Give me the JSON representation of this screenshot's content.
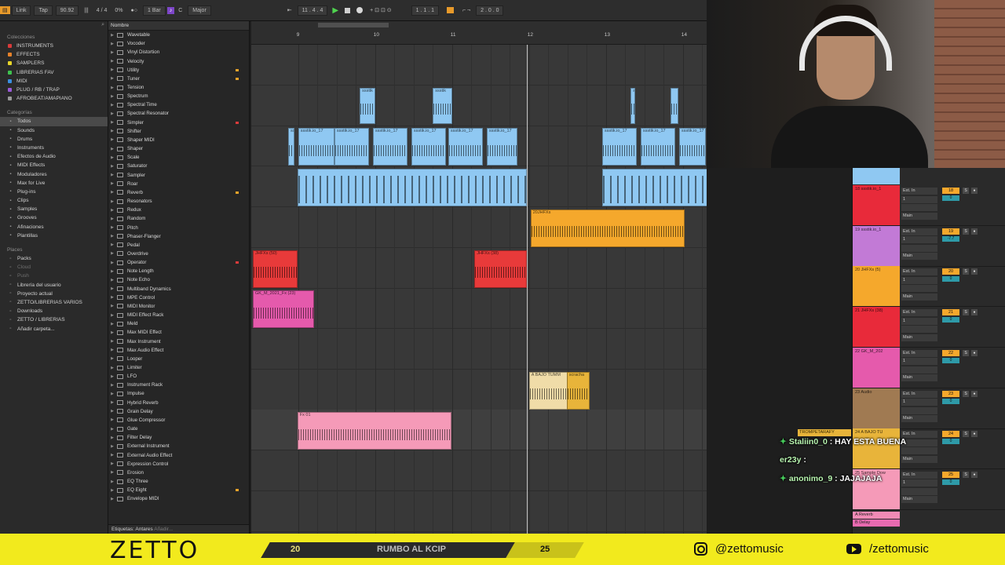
{
  "toolbar": {
    "link": "Link",
    "tap": "Tap",
    "tempo": "90.92",
    "signature": "4 / 4",
    "cpu": "0%",
    "quantize": "1 Bar",
    "key": "C",
    "scale": "Major",
    "position": "11 .   4 .   4",
    "loop_start": "1 .   1 .   1",
    "loop_length": "2 .   0 .   0"
  },
  "browser": {
    "collections_title": "Colecciones",
    "collections": [
      {
        "label": "INSTRUMENTS",
        "color": "#d93b3b"
      },
      {
        "label": "EFFECTS",
        "color": "#e8822a"
      },
      {
        "label": "SAMPLERS",
        "color": "#e8d62a"
      },
      {
        "label": "LIBRERIAS FAV",
        "color": "#3ec24f"
      },
      {
        "label": "MIDI",
        "color": "#3a8fe0"
      },
      {
        "label": "PLUG / RB / TRAP",
        "color": "#9b5ad8"
      },
      {
        "label": "AFROBEAT/AMAPIANO",
        "color": "#9a9a9a"
      }
    ],
    "categories_title": "Categorías",
    "categories": [
      {
        "label": "Todos",
        "icon": "grid-icon"
      },
      {
        "label": "Sounds",
        "icon": "sound-icon"
      },
      {
        "label": "Drums",
        "icon": "drum-icon"
      },
      {
        "label": "Instruments",
        "icon": "instrument-icon"
      },
      {
        "label": "Efectos de Audio",
        "icon": "audio-effect-icon"
      },
      {
        "label": "MIDI Effects",
        "icon": "midi-effect-icon"
      },
      {
        "label": "Moduladores",
        "icon": "modulator-icon"
      },
      {
        "label": "Max for Live",
        "icon": "max-icon"
      },
      {
        "label": "Plug-ins",
        "icon": "plugin-icon"
      },
      {
        "label": "Clips",
        "icon": "clip-icon"
      },
      {
        "label": "Samples",
        "icon": "sample-icon"
      },
      {
        "label": "Grooves",
        "icon": "groove-icon"
      },
      {
        "label": "Afinaciones",
        "icon": "tuning-icon"
      },
      {
        "label": "Plantillas",
        "icon": "template-icon"
      }
    ],
    "places_title": "Places",
    "places": [
      {
        "label": "Packs",
        "icon": "pack-icon",
        "dim": false
      },
      {
        "label": "Cloud",
        "icon": "cloud-icon",
        "dim": true
      },
      {
        "label": "Push",
        "icon": "push-icon",
        "dim": true
      },
      {
        "label": "Librería del usuario",
        "icon": "folder-icon",
        "dim": false
      },
      {
        "label": "Proyecto actual",
        "icon": "folder-icon",
        "dim": false
      },
      {
        "label": "ZETTO/LIBRERIAS VARIOS",
        "icon": "folder-icon",
        "dim": false
      },
      {
        "label": "Downloads",
        "icon": "folder-icon",
        "dim": false
      },
      {
        "label": "ZETTO / LIBRERIAS",
        "icon": "folder-icon",
        "dim": false
      },
      {
        "label": "Añadir carpeta...",
        "icon": "add-icon",
        "dim": false
      }
    ]
  },
  "filelist": {
    "header": "Nombre",
    "items": [
      {
        "label": "Wavetable",
        "mark": ""
      },
      {
        "label": "Vocoder",
        "mark": ""
      },
      {
        "label": "Vinyl Distortion",
        "mark": ""
      },
      {
        "label": "Velocity",
        "mark": ""
      },
      {
        "label": "Utility",
        "mark": "#e8a32a"
      },
      {
        "label": "Tuner",
        "mark": "#e8a32a"
      },
      {
        "label": "Tension",
        "mark": ""
      },
      {
        "label": "Spectrum",
        "mark": ""
      },
      {
        "label": "Spectral Time",
        "mark": ""
      },
      {
        "label": "Spectral Resonator",
        "mark": ""
      },
      {
        "label": "Simpler",
        "mark": "#d93b3b"
      },
      {
        "label": "Shifter",
        "mark": ""
      },
      {
        "label": "Shaper MIDI",
        "mark": ""
      },
      {
        "label": "Shaper",
        "mark": ""
      },
      {
        "label": "Scale",
        "mark": ""
      },
      {
        "label": "Saturator",
        "mark": ""
      },
      {
        "label": "Sampler",
        "mark": ""
      },
      {
        "label": "Roar",
        "mark": ""
      },
      {
        "label": "Reverb",
        "mark": "#e8a32a"
      },
      {
        "label": "Resonators",
        "mark": ""
      },
      {
        "label": "Redux",
        "mark": ""
      },
      {
        "label": "Random",
        "mark": ""
      },
      {
        "label": "Pitch",
        "mark": ""
      },
      {
        "label": "Phaser-Flanger",
        "mark": ""
      },
      {
        "label": "Pedal",
        "mark": ""
      },
      {
        "label": "Overdrive",
        "mark": ""
      },
      {
        "label": "Operator",
        "mark": "#d93b3b"
      },
      {
        "label": "Note Length",
        "mark": ""
      },
      {
        "label": "Note Echo",
        "mark": ""
      },
      {
        "label": "Multiband Dynamics",
        "mark": ""
      },
      {
        "label": "MPE Control",
        "mark": ""
      },
      {
        "label": "MIDI Monitor",
        "mark": ""
      },
      {
        "label": "MIDI Effect Rack",
        "mark": ""
      },
      {
        "label": "Meld",
        "mark": ""
      },
      {
        "label": "Max MIDI Effect",
        "mark": ""
      },
      {
        "label": "Max Instrument",
        "mark": ""
      },
      {
        "label": "Max Audio Effect",
        "mark": ""
      },
      {
        "label": "Looper",
        "mark": ""
      },
      {
        "label": "Limiter",
        "mark": ""
      },
      {
        "label": "LFO",
        "mark": ""
      },
      {
        "label": "Instrument Rack",
        "mark": ""
      },
      {
        "label": "Impulse",
        "mark": ""
      },
      {
        "label": "Hybrid Reverb",
        "mark": ""
      },
      {
        "label": "Grain Delay",
        "mark": ""
      },
      {
        "label": "Glue Compressor",
        "mark": ""
      },
      {
        "label": "Gate",
        "mark": ""
      },
      {
        "label": "Filter Delay",
        "mark": ""
      },
      {
        "label": "External Instrument",
        "mark": ""
      },
      {
        "label": "External Audio Effect",
        "mark": ""
      },
      {
        "label": "Expression Control",
        "mark": ""
      },
      {
        "label": "Erosion",
        "mark": ""
      },
      {
        "label": "EQ Three",
        "mark": ""
      },
      {
        "label": "EQ Eight",
        "mark": "#e8a32a"
      },
      {
        "label": "Envelope MIDI",
        "mark": ""
      }
    ],
    "footer_label": "Etiquetas:",
    "footer_tag": "Antares",
    "footer_add": "Añadir..."
  },
  "ruler": {
    "bars": [
      "9",
      "10",
      "11",
      "12",
      "13",
      "14"
    ]
  },
  "clips": [
    {
      "name": "ssstik",
      "lane": 2,
      "bar": 9.8,
      "len": 0.2,
      "color": "#8fc8f2",
      "style": "wave"
    },
    {
      "name": "ssstik",
      "lane": 2,
      "bar": 10.75,
      "len": 0.25,
      "color": "#8fc8f2",
      "style": "wave"
    },
    {
      "name": "s",
      "lane": 2,
      "bar": 13.32,
      "len": 0.06,
      "color": "#8fc8f2",
      "style": "wave"
    },
    {
      "name": "",
      "lane": 2,
      "bar": 13.84,
      "len": 0.1,
      "color": "#8fc8f2",
      "style": "wave"
    },
    {
      "name": "ssstik.io_17",
      "lane": 3,
      "bar": 8.87,
      "len": 0.08,
      "color": "#8fc8f2",
      "style": "wave"
    },
    {
      "name": "ssstik.io_17",
      "lane": 3,
      "bar": 9.0,
      "len": 0.47,
      "color": "#8fc8f2",
      "style": "wave"
    },
    {
      "name": "ssstik.io_17",
      "lane": 3,
      "bar": 9.47,
      "len": 0.45,
      "color": "#8fc8f2",
      "style": "wave"
    },
    {
      "name": "ssstik.io_17",
      "lane": 3,
      "bar": 9.97,
      "len": 0.45,
      "color": "#8fc8f2",
      "style": "wave"
    },
    {
      "name": "ssstik.io_17",
      "lane": 3,
      "bar": 10.47,
      "len": 0.45,
      "color": "#8fc8f2",
      "style": "wave"
    },
    {
      "name": "ssstik.io_17",
      "lane": 3,
      "bar": 10.95,
      "len": 0.45,
      "color": "#8fc8f2",
      "style": "wave"
    },
    {
      "name": "ssstik.io_17",
      "lane": 3,
      "bar": 11.45,
      "len": 0.4,
      "color": "#8fc8f2",
      "style": "wave"
    },
    {
      "name": "ssstik.io_17",
      "lane": 3,
      "bar": 12.95,
      "len": 0.45,
      "color": "#8fc8f2",
      "style": "wave"
    },
    {
      "name": "ssstik.io_17",
      "lane": 3,
      "bar": 13.45,
      "len": 0.45,
      "color": "#8fc8f2",
      "style": "wave"
    },
    {
      "name": "ssstik.io_17",
      "lane": 3,
      "bar": 13.95,
      "len": 0.35,
      "color": "#8fc8f2",
      "style": "wave"
    },
    {
      "name": "",
      "lane": 4,
      "bar": 8.99,
      "len": 2.98,
      "color": "#8fc8f2",
      "style": "stripe"
    },
    {
      "name": "",
      "lane": 4,
      "bar": 12.95,
      "len": 1.37,
      "color": "#8fc8f2",
      "style": "stripe"
    },
    {
      "name": "20JHFXs",
      "lane": 5,
      "bar": 12.02,
      "len": 2.0,
      "color": "#f5a82c",
      "style": "wave"
    },
    {
      "name": "JHFXs (50)",
      "lane": 6,
      "bar": 8.41,
      "len": 0.58,
      "color": "#e83a3a",
      "style": "wave"
    },
    {
      "name": "JHFXs (38)",
      "lane": 6,
      "bar": 11.29,
      "len": 0.68,
      "color": "#e83a3a",
      "style": "wave"
    },
    {
      "name": "GK_M_2021_Fx (23)",
      "lane": 7,
      "bar": 8.41,
      "len": 0.8,
      "color": "#e55aac",
      "style": "wave"
    },
    {
      "name": "A BAJO TUMM",
      "lane": 9,
      "bar": 12.0,
      "len": 0.5,
      "color": "#f0dca8",
      "style": "wave"
    },
    {
      "name": "scracha",
      "lane": 9,
      "bar": 12.49,
      "len": 0.3,
      "color": "#e8b43a",
      "style": "wave"
    },
    {
      "name": "Fx 01",
      "lane": 10,
      "bar": 8.99,
      "len": 2.0,
      "color": "#f59ab8",
      "style": "wave"
    }
  ],
  "mixer": {
    "tracks": [
      {
        "name": "18 ssstik.io_1",
        "color": "#e82a3a",
        "input": "Ext. In",
        "ch": "1",
        "out": "Main",
        "num": "18",
        "vol": "0",
        "numcolor": "#f5a82c"
      },
      {
        "name": "19 ssstik.io_1",
        "color": "#c27ad6",
        "input": "Ext. In",
        "ch": "1",
        "out": "Main",
        "num": "19",
        "vol": "-7.7",
        "numcolor": "#f5a82c"
      },
      {
        "name": "20 JHFXs (5)",
        "color": "#f5a82c",
        "input": "Ext. In",
        "ch": "1",
        "out": "Main",
        "num": "20",
        "vol": "0",
        "numcolor": "#f5a82c"
      },
      {
        "name": "21 JHFXs (38)",
        "color": "#e82a3a",
        "input": "Ext. In",
        "ch": "1",
        "out": "Main",
        "num": "21",
        "vol": "0",
        "numcolor": "#f5a82c"
      },
      {
        "name": "22 GK_M_202",
        "color": "#e55aac",
        "input": "Ext. In",
        "ch": "1",
        "out": "Main",
        "num": "22",
        "vol": "0",
        "numcolor": "#f5a82c"
      },
      {
        "name": "23 Audio",
        "color": "#a07a52",
        "input": "Ext. In",
        "ch": "1",
        "out": "Main",
        "num": "23",
        "vol": "0",
        "numcolor": "#f5a82c"
      },
      {
        "name": "24 A BAJO TU",
        "color": "#e8b43a",
        "input": "Ext. In",
        "ch": "1",
        "out": "Main",
        "num": "24",
        "vol": "0",
        "numcolor": "#f5a82c"
      },
      {
        "name": "25 Sample Dow",
        "color": "#f59ab8",
        "input": "Ext. In",
        "ch": "1",
        "out": "Main",
        "num": "25",
        "vol": "0",
        "numcolor": "#f5a82c"
      }
    ],
    "returns": [
      "A Reverb",
      "B Delay"
    ]
  },
  "chat": [
    {
      "user": "Staliin0_0",
      "text": " : HAY ESTA BUENA"
    },
    {
      "user": "er23y",
      "text": " :"
    },
    {
      "user": "anonimo_9",
      "text": " : JAJAJAJA"
    }
  ],
  "overlay_label": "TROMPETARAFY",
  "banner": {
    "brand": "ZETTO",
    "progress_from": "20",
    "progress_label": "RUMBO AL KCIP",
    "progress_to": "25",
    "progress_fraction": 0.78,
    "instagram": "@zettomusic",
    "youtube": "/zettomusic"
  }
}
